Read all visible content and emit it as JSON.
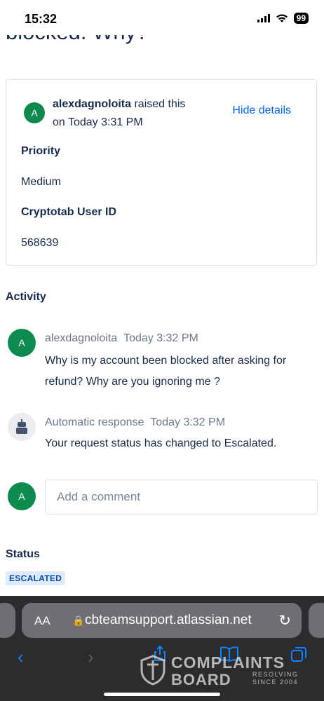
{
  "status_bar": {
    "time": "15:32",
    "battery": "99"
  },
  "page": {
    "clipped_title": "blocked. Why?"
  },
  "details": {
    "avatar_letter": "A",
    "reporter": "alexdagnoloita",
    "raised_suffix": " raised this",
    "raised_time": "on Today 3:31 PM",
    "hide_details": "Hide details",
    "priority_label": "Priority",
    "priority_value": "Medium",
    "user_id_label": "Cryptotab User ID",
    "user_id_value": "568639"
  },
  "activity": {
    "title": "Activity",
    "items": [
      {
        "avatar_letter": "A",
        "author": "alexdagnoloita",
        "time": "Today 3:32 PM",
        "body": "Why is my account been blocked after asking for refund? Why are you ignoring me ?"
      },
      {
        "avatar_icon": "robot-icon",
        "author": "Automatic response",
        "time": "Today 3:32 PM",
        "body": "Your request status has changed to Escalated."
      }
    ]
  },
  "comment": {
    "avatar_letter": "A",
    "placeholder": "Add a comment"
  },
  "status": {
    "title": "Status",
    "badge": "ESCALATED"
  },
  "browser": {
    "aa": "AA",
    "url": "cbteamsupport.atlassian.net"
  },
  "watermark": {
    "line1": "COMPLAINTS",
    "line2": "BOARD",
    "tag1": "RESOLVING",
    "tag2": "SINCE 2004"
  },
  "colors": {
    "avatar_green": "#0d8a4d",
    "link_blue": "#0065ff",
    "badge_bg": "#deebff",
    "badge_text": "#0747a6"
  }
}
